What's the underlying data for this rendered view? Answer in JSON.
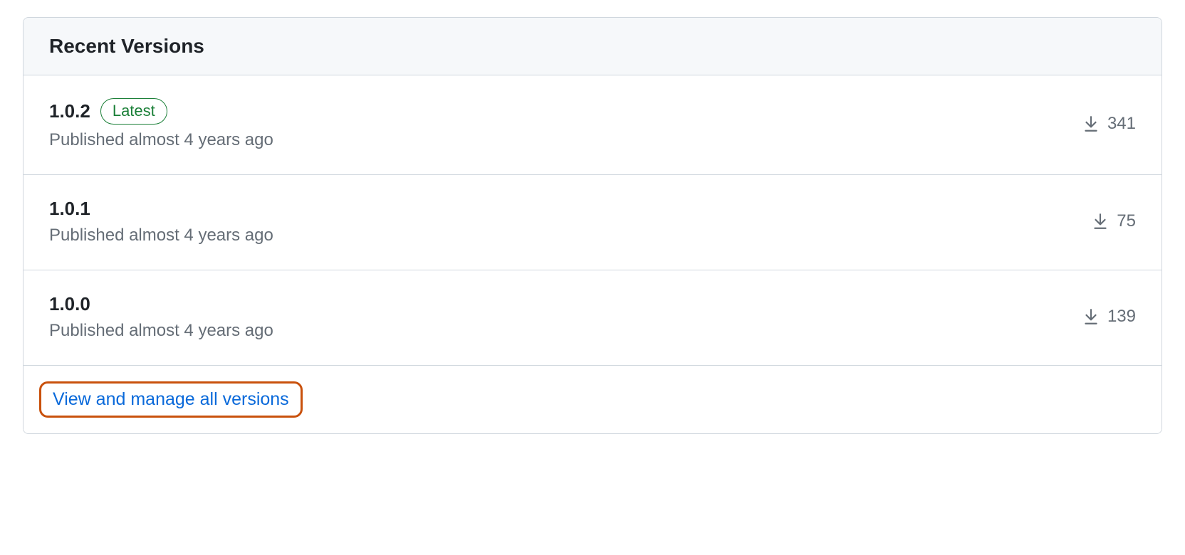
{
  "header": {
    "title": "Recent Versions"
  },
  "versions": [
    {
      "number": "1.0.2",
      "latest": true,
      "latest_label": "Latest",
      "published": "Published almost 4 years ago",
      "downloads": "341"
    },
    {
      "number": "1.0.1",
      "latest": false,
      "published": "Published almost 4 years ago",
      "downloads": "75"
    },
    {
      "number": "1.0.0",
      "latest": false,
      "published": "Published almost 4 years ago",
      "downloads": "139"
    }
  ],
  "footer": {
    "manage_link": "View and manage all versions"
  }
}
